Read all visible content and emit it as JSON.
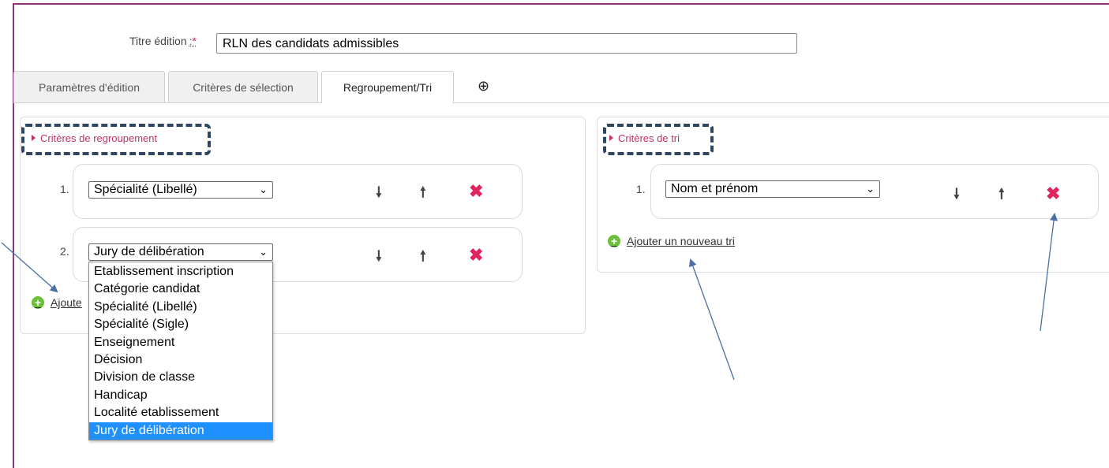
{
  "form": {
    "title_label": "Titre édition",
    "required_mark": ":*",
    "title_value": "RLN des candidats admissibles"
  },
  "tabs": [
    {
      "label": "Paramètres d'édition",
      "active": false
    },
    {
      "label": "Critères de sélection",
      "active": false
    },
    {
      "label": "Regroupement/Tri",
      "active": true
    }
  ],
  "tab_add_icon": "⊕",
  "grouping": {
    "title": "Critères de regroupement",
    "rows": [
      {
        "num": "1.",
        "value": "Spécialité (Libellé)"
      },
      {
        "num": "2.",
        "value": "Jury de délibération"
      }
    ],
    "add_label": "Ajoute"
  },
  "sorting": {
    "title": "Critères de tri",
    "rows": [
      {
        "num": "1.",
        "value": "Nom et prénom"
      }
    ],
    "add_label": "Ajouter un nouveau tri"
  },
  "dropdown_options": [
    "Etablissement inscription",
    "Catégorie candidat",
    "Spécialité (Libellé)",
    "Spécialité (Sigle)",
    "Enseignement",
    "Décision",
    "Division de classe",
    "Handicap",
    "Localité etablissement",
    "Jury de délibération"
  ],
  "dropdown_selected_index": 9,
  "icons": {
    "move_down": "🠗",
    "move_up": "🠕",
    "delete": "✖",
    "chevron": "⌄"
  },
  "colors": {
    "accent": "#c0306a",
    "delete": "#e0245e",
    "selected_option": "#1e90ff",
    "annotation_arrow": "#4a6fa5",
    "dash_box": "#2f4660"
  }
}
